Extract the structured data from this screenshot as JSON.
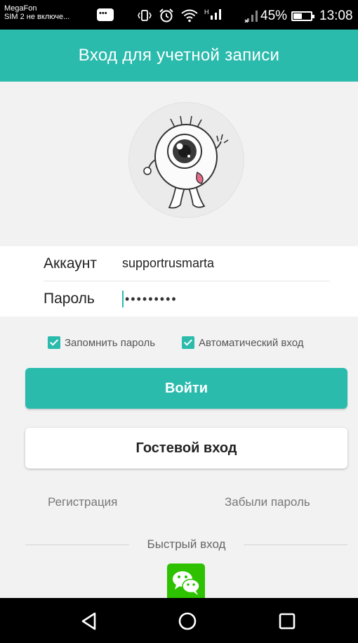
{
  "status_bar": {
    "carrier_line1": "MegaFon",
    "carrier_line2": "SIM 2 не включе...",
    "network": "H",
    "battery": "45%",
    "battery_level": 0.45,
    "time": "13:08"
  },
  "header": {
    "title": "Вход для учетной записи"
  },
  "form": {
    "account_label": "Аккаунт",
    "account_value": "supportrusmarta",
    "password_label": "Пароль",
    "password_value": "•••••••••"
  },
  "options": {
    "remember_label": "Запомнить пароль",
    "remember_checked": true,
    "autologin_label": "Автоматический вход",
    "autologin_checked": true
  },
  "buttons": {
    "login": "Войти",
    "guest": "Гостевой вход"
  },
  "links": {
    "register": "Регистрация",
    "forgot": "Забыли пароль"
  },
  "quick_login": {
    "label": "Быстрый вход"
  },
  "colors": {
    "accent": "#2bbbad",
    "wechat": "#2dc100",
    "background": "#f2f2f2"
  },
  "icons": {
    "avatar": "eyeball-mascot-icon",
    "quick_login": "wechat-icon",
    "nav_back": "triangle-back-icon",
    "nav_home": "circle-home-icon",
    "nav_recent": "square-recent-icon"
  }
}
